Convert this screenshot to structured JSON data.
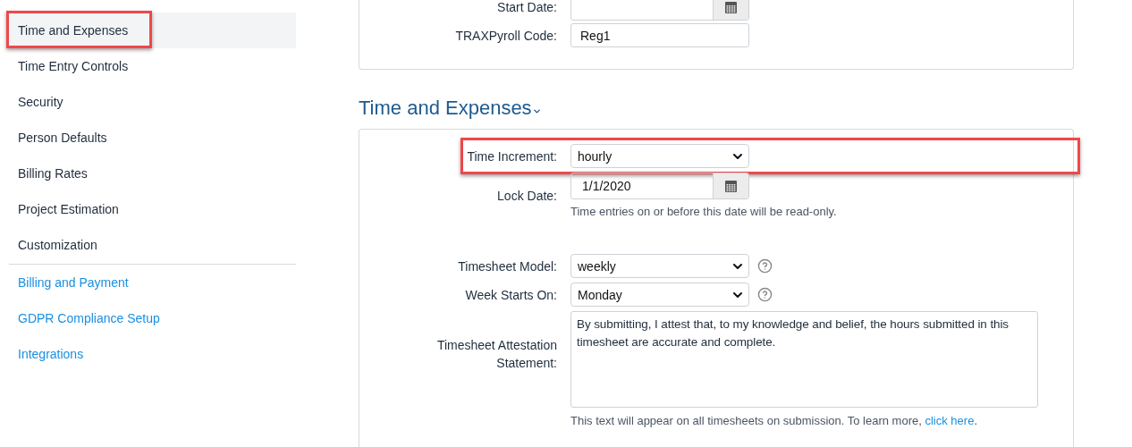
{
  "sidebar": {
    "settings": [
      {
        "label": "Time and Expenses",
        "selected": true,
        "highlighted": true
      },
      {
        "label": "Time Entry Controls",
        "selected": false,
        "highlighted": false
      },
      {
        "label": "Security",
        "selected": false,
        "highlighted": false
      },
      {
        "label": "Person Defaults",
        "selected": false,
        "highlighted": false
      },
      {
        "label": "Billing Rates",
        "selected": false,
        "highlighted": false
      },
      {
        "label": "Project Estimation",
        "selected": false,
        "highlighted": false
      },
      {
        "label": "Customization",
        "selected": false,
        "highlighted": false
      }
    ],
    "links": [
      {
        "label": "Billing and Payment"
      },
      {
        "label": "GDPR Compliance Setup"
      },
      {
        "label": "Integrations"
      }
    ]
  },
  "top_card": {
    "fields": [
      {
        "kind": "date",
        "label": "Start Date:",
        "highlighted": false
      },
      {
        "kind": "text",
        "label": "TRAXPyroll Code:",
        "value": "Reg1",
        "highlighted": false
      }
    ]
  },
  "section": {
    "title": "Time and Expenses",
    "expanded": true,
    "fields": [
      {
        "kind": "select",
        "label": "Time Increment:",
        "value": "hourly",
        "highlighted": true,
        "help": false
      },
      {
        "kind": "date",
        "label": "Lock Date:",
        "value": "1/1/2020",
        "highlighted": false,
        "hint": {
          "text": "Time entries on or before this date will be read-only."
        }
      },
      {
        "kind": "select",
        "label": "Timesheet Model:",
        "value": "weekly",
        "highlighted": false,
        "help": true
      },
      {
        "kind": "select",
        "label": "Week Starts On:",
        "value": "Monday",
        "highlighted": false,
        "help": true
      },
      {
        "kind": "textarea",
        "label": "Timesheet Attestation Statement:",
        "value": "By submitting, I attest that, to my knowledge and belief, the hours submitted in this timesheet are accurate and complete.",
        "highlighted": false,
        "hint": {
          "text": "This text will appear on all timesheets on submission. To learn more, ",
          "link": "click here",
          "after": "."
        }
      }
    ]
  }
}
